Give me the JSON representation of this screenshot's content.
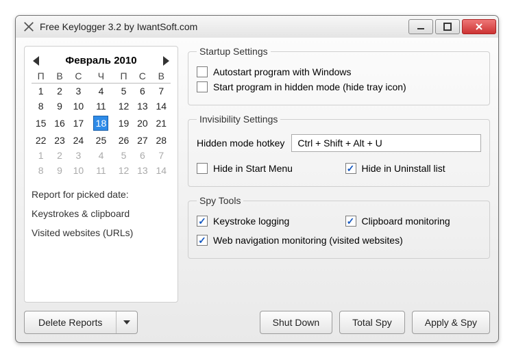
{
  "window": {
    "title": "Free Keylogger 3.2 by IwantSoft.com"
  },
  "calendar": {
    "month_label": "Февраль 2010",
    "dow": [
      "П",
      "В",
      "С",
      "Ч",
      "П",
      "С",
      "В"
    ],
    "weeks": [
      [
        {
          "d": "1"
        },
        {
          "d": "2"
        },
        {
          "d": "3"
        },
        {
          "d": "4"
        },
        {
          "d": "5"
        },
        {
          "d": "6"
        },
        {
          "d": "7"
        }
      ],
      [
        {
          "d": "8"
        },
        {
          "d": "9"
        },
        {
          "d": "10"
        },
        {
          "d": "11"
        },
        {
          "d": "12"
        },
        {
          "d": "13"
        },
        {
          "d": "14"
        }
      ],
      [
        {
          "d": "15"
        },
        {
          "d": "16"
        },
        {
          "d": "17"
        },
        {
          "d": "18",
          "sel": true
        },
        {
          "d": "19"
        },
        {
          "d": "20"
        },
        {
          "d": "21"
        }
      ],
      [
        {
          "d": "22"
        },
        {
          "d": "23"
        },
        {
          "d": "24"
        },
        {
          "d": "25"
        },
        {
          "d": "26"
        },
        {
          "d": "27"
        },
        {
          "d": "28"
        }
      ],
      [
        {
          "d": "1",
          "dim": true
        },
        {
          "d": "2",
          "dim": true
        },
        {
          "d": "3",
          "dim": true
        },
        {
          "d": "4",
          "dim": true
        },
        {
          "d": "5",
          "dim": true
        },
        {
          "d": "6",
          "dim": true
        },
        {
          "d": "7",
          "dim": true
        }
      ],
      [
        {
          "d": "8",
          "dim": true
        },
        {
          "d": "9",
          "dim": true
        },
        {
          "d": "10",
          "dim": true
        },
        {
          "d": "11",
          "dim": true
        },
        {
          "d": "12",
          "dim": true
        },
        {
          "d": "13",
          "dim": true
        },
        {
          "d": "14",
          "dim": true
        }
      ]
    ]
  },
  "reports": {
    "heading": "Report for picked date:",
    "line1": "Keystrokes & clipboard",
    "line2": "Visited websites (URLs)"
  },
  "startup": {
    "legend": "Startup Settings",
    "autostart": {
      "label": "Autostart program with Windows",
      "checked": false
    },
    "hidden_start": {
      "label": "Start program in hidden mode (hide tray icon)",
      "checked": false
    }
  },
  "invisibility": {
    "legend": "Invisibility Settings",
    "hotkey_label": "Hidden mode hotkey",
    "hotkey_value": "Ctrl + Shift + Alt + U",
    "hide_start_menu": {
      "label": "Hide in Start Menu",
      "checked": false
    },
    "hide_uninstall": {
      "label": "Hide in Uninstall list",
      "checked": true
    }
  },
  "spy": {
    "legend": "Spy Tools",
    "keystroke": {
      "label": "Keystroke logging",
      "checked": true
    },
    "clipboard": {
      "label": "Clipboard monitoring",
      "checked": true
    },
    "webnav": {
      "label": "Web navigation monitoring (visited websites)",
      "checked": true
    }
  },
  "buttons": {
    "delete_reports": "Delete Reports",
    "shut_down": "Shut Down",
    "total_spy": "Total Spy",
    "apply_spy": "Apply & Spy"
  }
}
